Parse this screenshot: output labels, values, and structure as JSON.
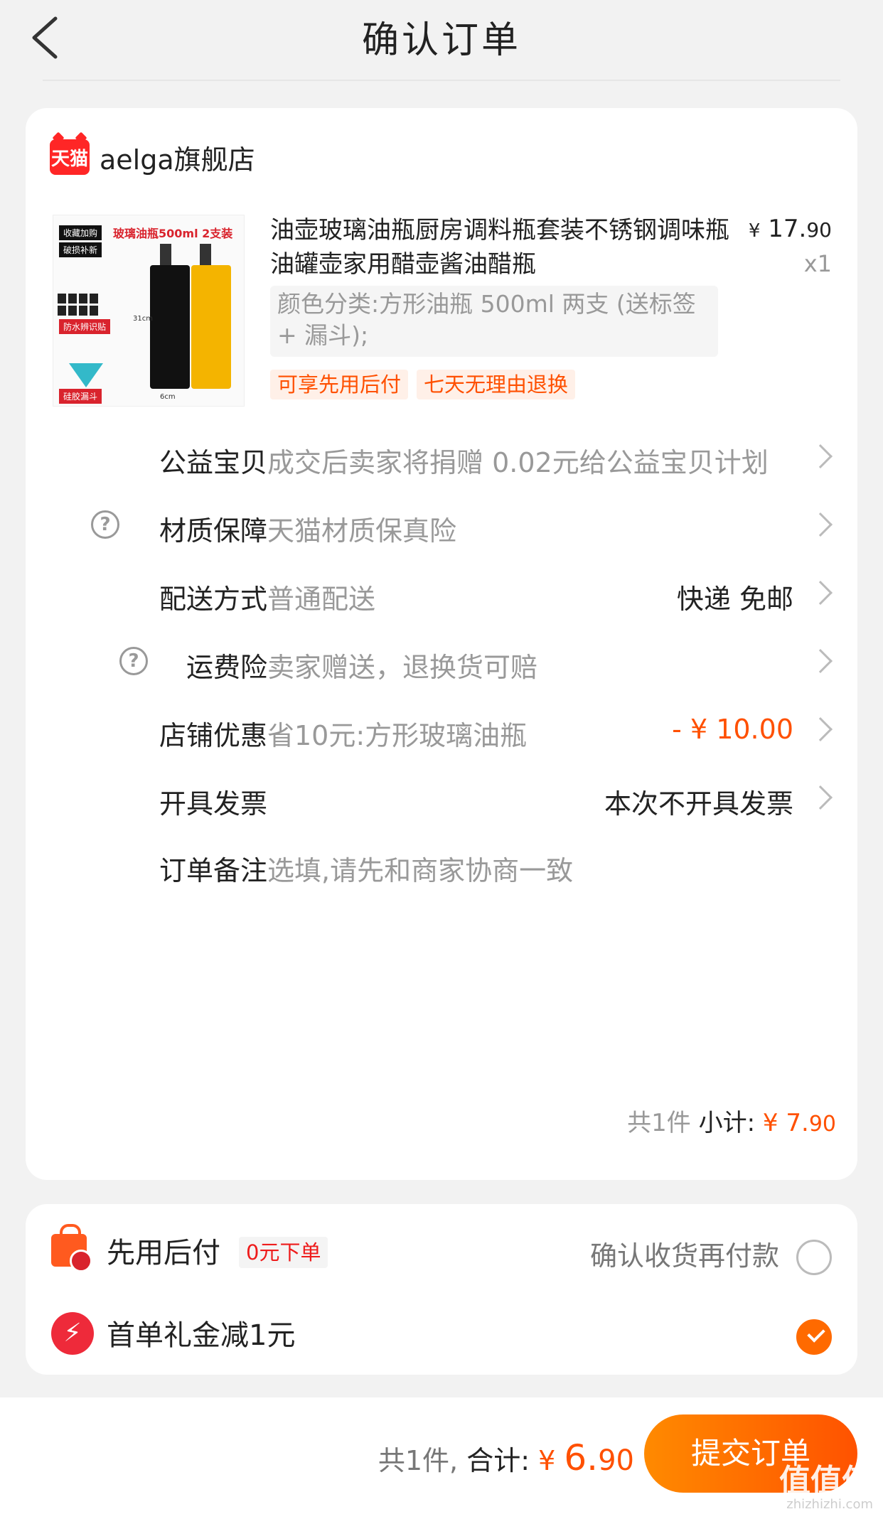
{
  "nav": {
    "title": "确认订单"
  },
  "shop": {
    "logo_text": "天猫",
    "name": "aelga旗舰店"
  },
  "product": {
    "image_texts": [
      "收藏加购",
      "破损补新",
      "玻璃油瓶500ml 2支装",
      "防水辨识贴",
      "硅胶漏斗",
      "31cm",
      "6cm"
    ],
    "title": "油壶玻璃油瓶厨房调料瓶套装不锈钢调味瓶油罐壶家用醋壶酱油醋瓶",
    "price_symbol": "¥",
    "price_int": "17.",
    "price_dec": "90",
    "qty": "x1",
    "sku": "颜色分类:方形油瓶 500ml 两支 (送标签 + 漏斗);",
    "tags": [
      "可享先用后付",
      "七天无理由退换"
    ]
  },
  "rows": [
    {
      "label": "公益宝贝",
      "desc": "成交后卖家将捐赠 0.02元给公益宝贝计划",
      "value": ""
    },
    {
      "label": "材质保障",
      "desc": "天猫材质保真险",
      "value": ""
    },
    {
      "label": "配送方式",
      "desc": "普通配送",
      "value": "快递 免邮"
    },
    {
      "label": "运费险",
      "desc": "卖家赠送，退换货可赔",
      "value": ""
    },
    {
      "label": "店铺优惠",
      "desc": "省10元:方形玻璃油瓶",
      "value": "- ¥ 10.00"
    },
    {
      "label": "开具发票",
      "desc": "",
      "value": "本次不开具发票"
    },
    {
      "label": "订单备注",
      "desc": "选填,请先和商家协商一致",
      "value": ""
    }
  ],
  "help_icon": "?",
  "subtotal": {
    "count": "共1件",
    "label": "小计:",
    "symbol": "¥ ",
    "int": "7.",
    "dec": "90"
  },
  "payment": {
    "later_label": "先用后付",
    "later_badge": "0元下单",
    "later_desc": "确认收货再付款",
    "later_checked": false,
    "gift_label": "首单礼金减1元",
    "gift_icon": "⚡",
    "gift_checked": true
  },
  "footer": {
    "count": "共1件,",
    "total_label": "合计:",
    "symbol": "¥ ",
    "int": "6.",
    "dec": "90",
    "submit_label": "提交订单"
  },
  "watermark": {
    "logo": "值值值",
    "text": "zhizhizhi.com"
  },
  "colors": {
    "accent": "#ff5000",
    "tmall_red": "#ff2626",
    "page_bg": "#f2f2f2"
  }
}
